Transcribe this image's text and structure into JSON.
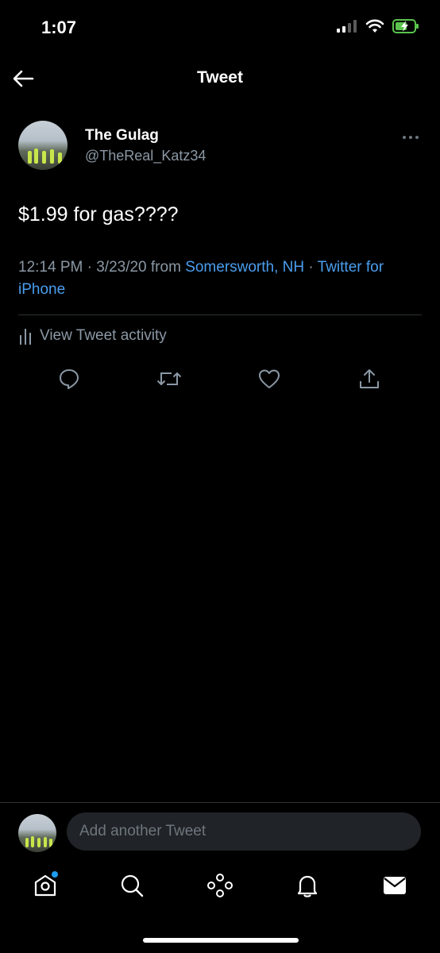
{
  "status_bar": {
    "time": "1:07"
  },
  "nav": {
    "title": "Tweet"
  },
  "tweet": {
    "author_name": "The Gulag",
    "author_handle": "@TheReal_Katz34",
    "text": "$1.99 for gas????",
    "time": "12:14 PM",
    "date": "3/23/20",
    "from_label": "from",
    "location": "Somersworth, NH",
    "source": "Twitter for iPhone",
    "separator": "·"
  },
  "activity": {
    "label": "View Tweet activity"
  },
  "compose": {
    "placeholder": "Add another Tweet"
  },
  "icons": {
    "back": "arrow-left-icon",
    "more": "more-horizontal-icon",
    "reply": "reply-icon",
    "retweet": "retweet-icon",
    "like": "heart-icon",
    "share": "share-icon",
    "home": "home-icon",
    "search": "search-icon",
    "spaces": "spaces-icon",
    "notifications": "bell-icon",
    "messages": "mail-icon"
  },
  "colors": {
    "background": "#000000",
    "text": "#e7e9ea",
    "secondary_text": "#8b98a5",
    "link": "#4a9ef0",
    "divider": "#2f3336",
    "accent": "#1d9bf0",
    "battery": "#5ac44d"
  }
}
